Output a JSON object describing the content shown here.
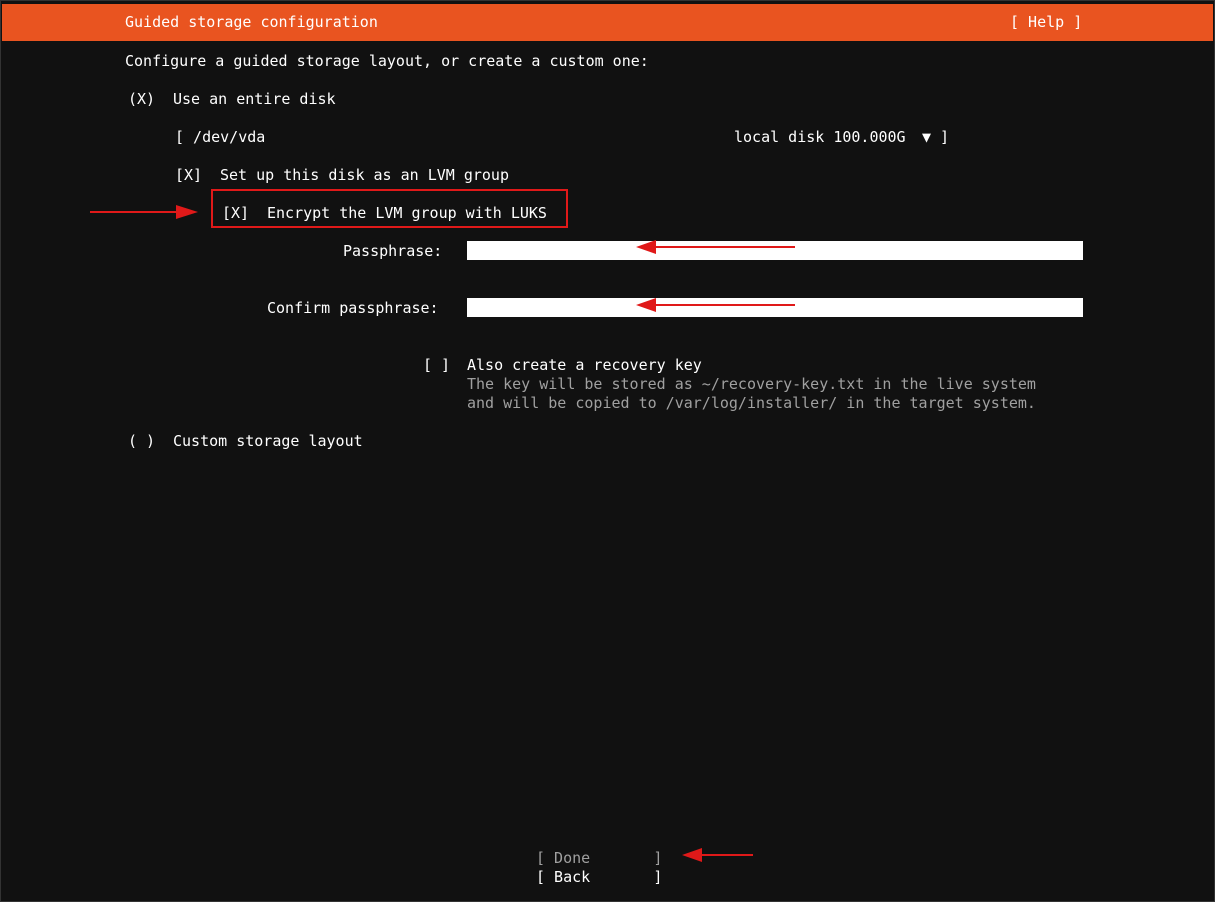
{
  "window": {
    "title": "Guided storage configuration",
    "help_label": "[ Help ]"
  },
  "intro": "Configure a guided storage layout, or create a custom one:",
  "entire_disk": {
    "radio": "(X)",
    "label": "Use an entire disk"
  },
  "disk_select": {
    "value": "[ /dev/vda",
    "info": "local disk 100.000G",
    "caret": "▼ ]"
  },
  "lvm": {
    "checkbox": "[X]",
    "label": "Set up this disk as an LVM group"
  },
  "luks": {
    "checkbox": "[X]",
    "label": "Encrypt the LVM group with LUKS"
  },
  "passphrase": {
    "label": "Passphrase:",
    "value": ""
  },
  "confirm_passphrase": {
    "label": "Confirm passphrase:",
    "value": ""
  },
  "recovery_key": {
    "checkbox": "[ ]",
    "label": "Also create a recovery key",
    "help_line1": "The key will be stored as ~/recovery-key.txt in the live system",
    "help_line2": "and will be copied to /var/log/installer/ in the target system."
  },
  "custom_layout": {
    "radio": "( )",
    "label": "Custom storage layout"
  },
  "buttons": {
    "done": "[ Done       ]",
    "back": "[ Back       ]"
  },
  "colors": {
    "accent": "#e95420",
    "annotation": "#e01919",
    "background": "#111111"
  }
}
